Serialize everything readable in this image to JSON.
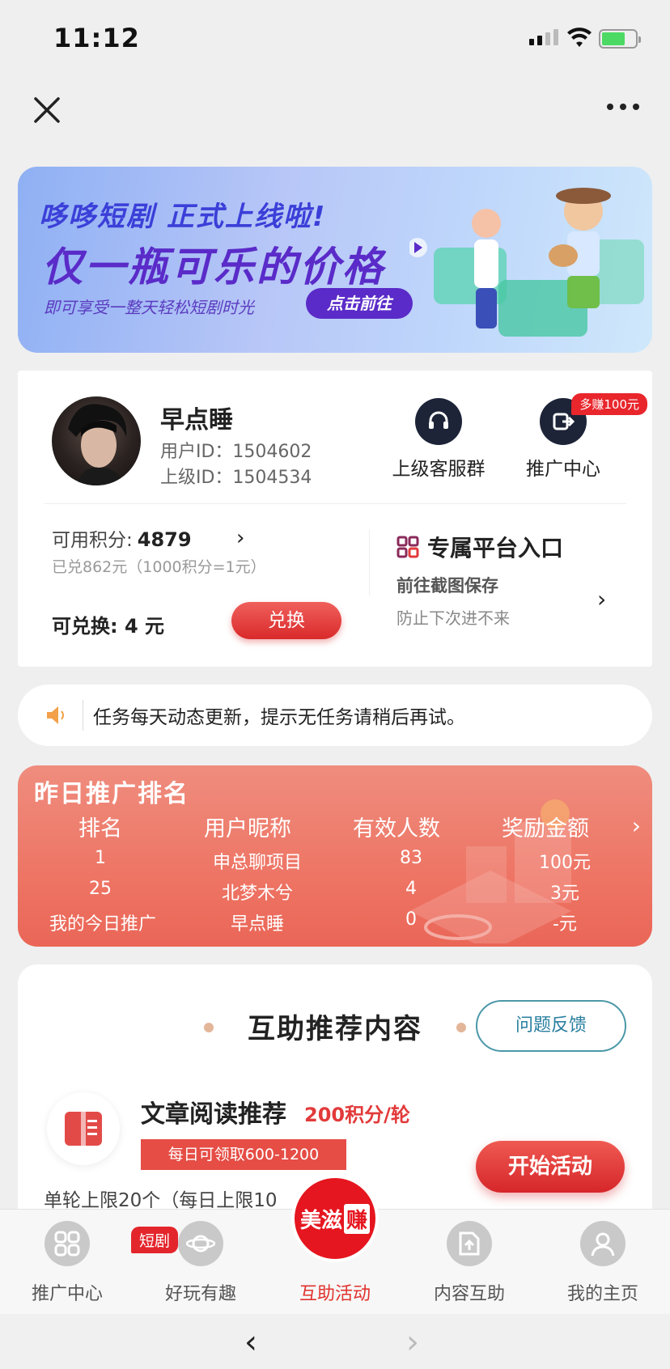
{
  "status": {
    "time": "11:12"
  },
  "banner": {
    "line1": "哆哆短剧 正式上线啦!",
    "line2": "仅一瓶可乐的价格",
    "line3": "即可享受一整天轻松短剧时光",
    "button": "点击前往"
  },
  "user": {
    "name": "早点睡",
    "user_id": "用户ID：1504602",
    "parent_id": "上级ID：1504534",
    "service_label": "上级客服群",
    "promo_label": "推广中心",
    "promo_badge": "多赚100元"
  },
  "points": {
    "label": "可用积分:",
    "value": "4879",
    "redeemed": "已兑862元（1000积分=1元）",
    "exchangeable": "可兑换: 4 元",
    "exchange_button": "兑换"
  },
  "platform": {
    "title": "专属平台入口",
    "sub1": "前往截图保存",
    "sub2": "防止下次进不来"
  },
  "notice": {
    "text": "任务每天动态更新，提示无任务请稍后再试。"
  },
  "ranking": {
    "title": "昨日推广排名",
    "headers": [
      "排名",
      "用户昵称",
      "有效人数",
      "奖励金额"
    ],
    "rows": [
      [
        "1",
        "申总聊项目",
        "83",
        "100元"
      ],
      [
        "25",
        "北梦木兮",
        "4",
        "3元"
      ],
      [
        "我的今日推广",
        "早点睡",
        "0",
        "-元"
      ]
    ]
  },
  "content": {
    "title": "互助推荐内容",
    "feedback": "问题反馈",
    "task_name": "文章阅读推荐",
    "task_points": "200积分/轮",
    "task_tag": "每日可领取600-1200",
    "start_button": "开始活动",
    "task_limit": "单轮上限20个（每日上限10"
  },
  "tabs": [
    {
      "label": "推广中心"
    },
    {
      "label": "好玩有趣"
    },
    {
      "label": "互助活动"
    },
    {
      "label": "内容互助"
    },
    {
      "label": "我的主页"
    }
  ],
  "tab_badge": "短剧",
  "center_logo": {
    "left": "美滋",
    "right": "赚"
  },
  "colors": {
    "accent": "#e0322e",
    "brand_red": "#e5161f",
    "banner_purple": "#5a2bc8",
    "feedback_teal": "#2a7fa0"
  }
}
